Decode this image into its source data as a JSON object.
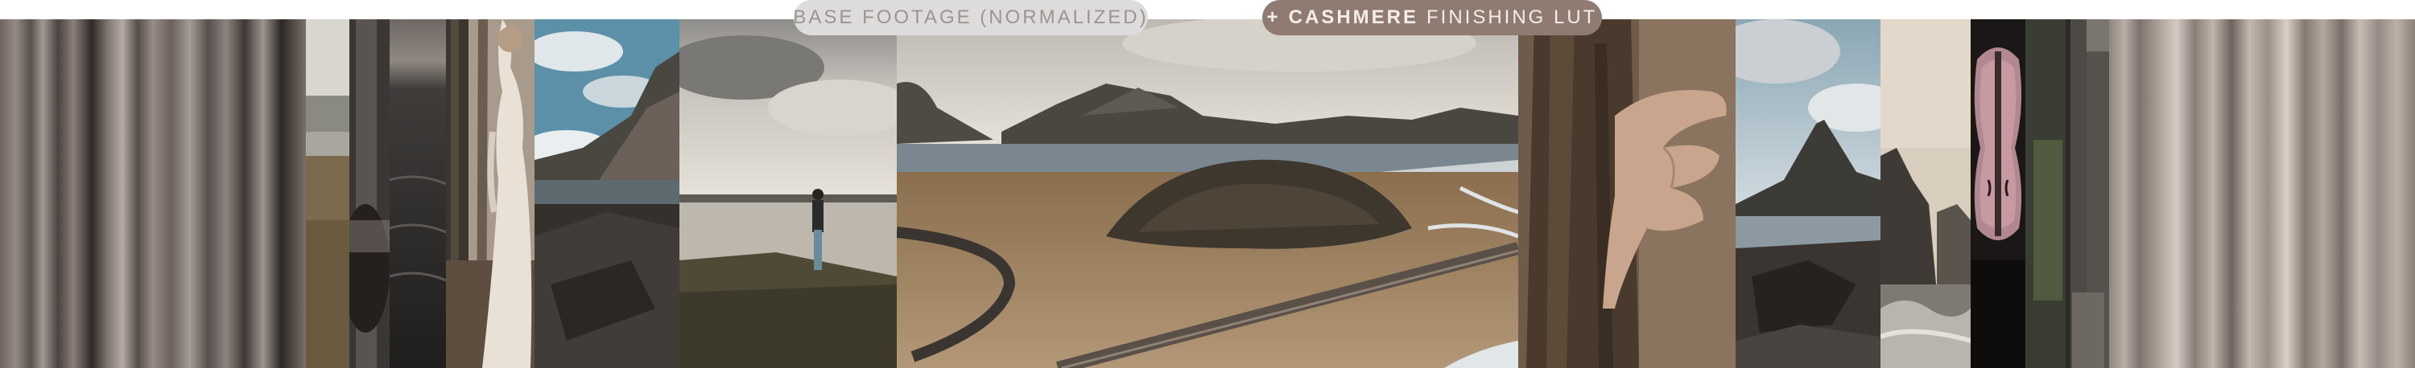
{
  "labels": {
    "base": "BASE FOOTAGE (NORMALIZED)",
    "lut_prefix": "+",
    "lut_name": "CASHMERE",
    "lut_suffix": "FINISHING LUT"
  },
  "colors": {
    "base_pill_bg": "#dedcda",
    "base_pill_text": "#9a9593",
    "lut_pill_bg": "#8f7b71",
    "lut_pill_text": "#f5eee9"
  },
  "panels": [
    "blurred-strip-left",
    "mountain-lake-thin",
    "gray-stone-slice",
    "dark-water-slice",
    "bride-in-lace-dress",
    "coastal-cliffs-sky",
    "woman-standing-by-lake",
    "aerial-road-mountains",
    "hand-on-tree-bark",
    "pyramid-mountain-rocky-shore",
    "sea-stack-waves",
    "violin-closeup",
    "dark-green-slice",
    "blurred-strip-right"
  ]
}
